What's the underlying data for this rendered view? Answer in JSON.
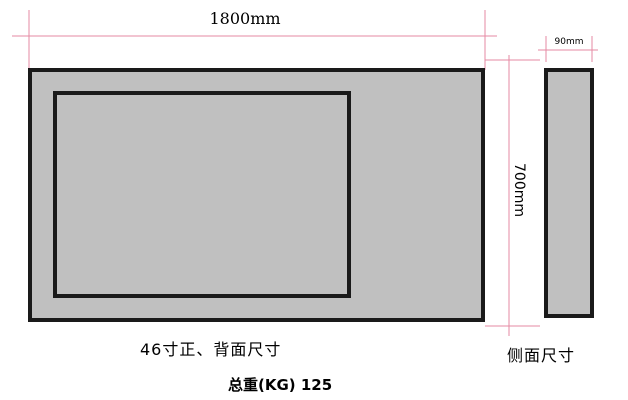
{
  "dimensions": {
    "width": "1800mm",
    "height": "700mm",
    "depth": "90mm"
  },
  "captions": {
    "front_back": "46寸正、背面尺寸",
    "side": "侧面尺寸",
    "weight": "总重(KG) 125"
  },
  "colors": {
    "panel_fill": "#c0c0c0",
    "panel_border": "#1a1a1a",
    "dimension_line": "#e58aa3",
    "background": "#ffffff"
  }
}
